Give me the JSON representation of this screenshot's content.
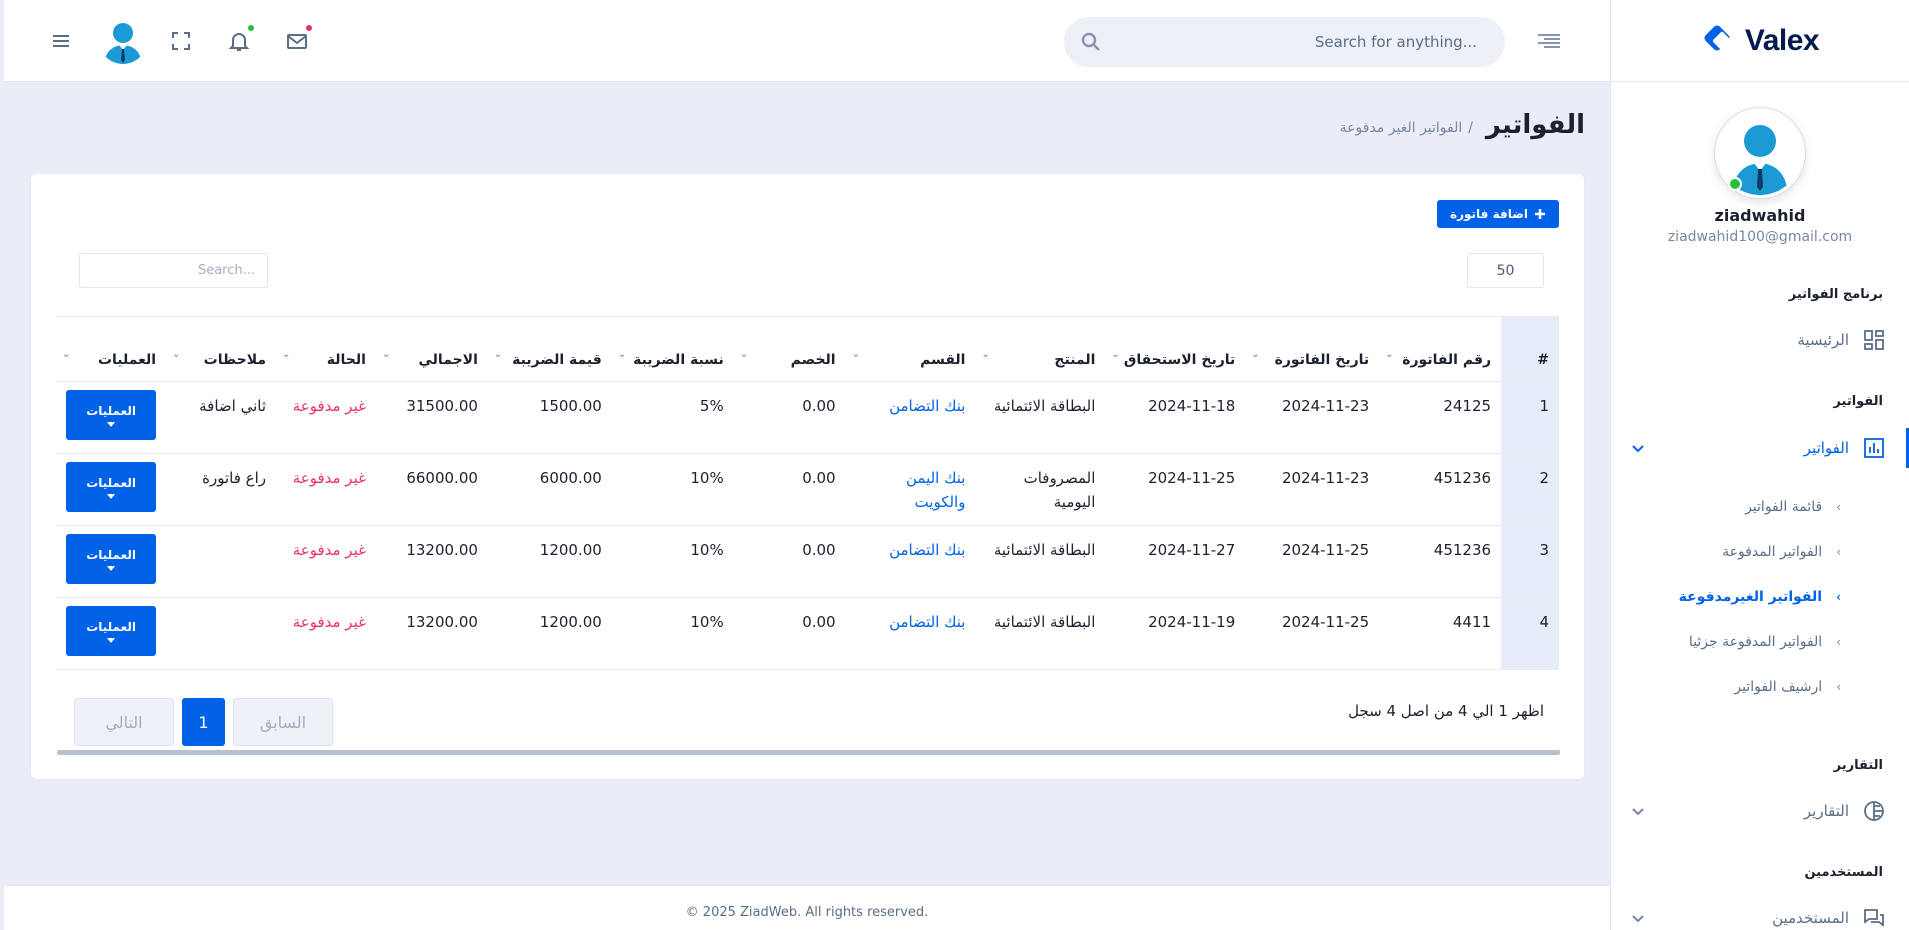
{
  "brand": {
    "logo_text": "Valex"
  },
  "user": {
    "name": "ziadwahid",
    "email": "ziadwahid100@gmail.com"
  },
  "header": {
    "search_placeholder": "Search for anything..."
  },
  "sidebar": {
    "cat_program": "برنامج الفواتير",
    "home": "الرئيسية",
    "cat_invoices": "الفواتير",
    "invoices": "الفواتير",
    "sub": [
      "قائمة الفواتير",
      "الفواتير المدفوعة",
      "الفواتير الغيرمدفوعة",
      "الفواتير المدفوعة جزئيا",
      "ارشيف الفواتير"
    ],
    "cat_reports": "التقارير",
    "reports": "التقارير",
    "cat_users": "المستخدمين",
    "users": "المستخدمين"
  },
  "page": {
    "title": "الفواتير",
    "breadcrumb": "الفواتير الغير مدفوعة",
    "breadcrumb_sep": "/"
  },
  "card": {
    "add_button": "اضافة فاتورة",
    "page_length": "50",
    "search_placeholder": "Search...",
    "columns": [
      "#",
      "رقم الفاتورة",
      "تاريخ الفاتورة",
      "تاريخ الاستحقاق",
      "المنتج",
      "القسم",
      "الخصم",
      "نسبة الضريبة",
      "قيمة الضريبة",
      "الاجمالي",
      "الحالة",
      "ملاحظات",
      "العمليات"
    ],
    "rows": [
      [
        "1",
        "24125",
        "2024-11-23",
        "2024-11-18",
        "البطاقة الائتمائية",
        "بنك التضامن",
        "0.00",
        "5%",
        "1500.00",
        "31500.00",
        "غير مدفوعة",
        "ثاني اضافة"
      ],
      [
        "2",
        "451236",
        "2024-11-23",
        "2024-11-25",
        "المصروفات اليومية",
        "بنك اليمن والكويت",
        "0.00",
        "10%",
        "6000.00",
        "66000.00",
        "غير مدفوعة",
        "راع فاتورة"
      ],
      [
        "3",
        "451236",
        "2024-11-25",
        "2024-11-27",
        "البطاقة الائتمائية",
        "بنك التضامن",
        "0.00",
        "10%",
        "1200.00",
        "13200.00",
        "غير مدفوعة",
        ""
      ],
      [
        "4",
        "4411",
        "2024-11-25",
        "2024-11-19",
        "البطاقة الائتمائية",
        "بنك التضامن",
        "0.00",
        "10%",
        "1200.00",
        "13200.00",
        "غير مدفوعة",
        ""
      ]
    ],
    "ops_label": "العمليات",
    "info": "اظهر 1 الي 4 من اصل 4 سجل",
    "pager": {
      "prev": "السابق",
      "current": "1",
      "next": "التالي"
    }
  },
  "footer": {
    "text": "© 2025 ZiadWeb. All rights reserved."
  },
  "colors": {
    "primary": "#0162e8",
    "danger": "#ee335e",
    "success": "#22c03c"
  }
}
